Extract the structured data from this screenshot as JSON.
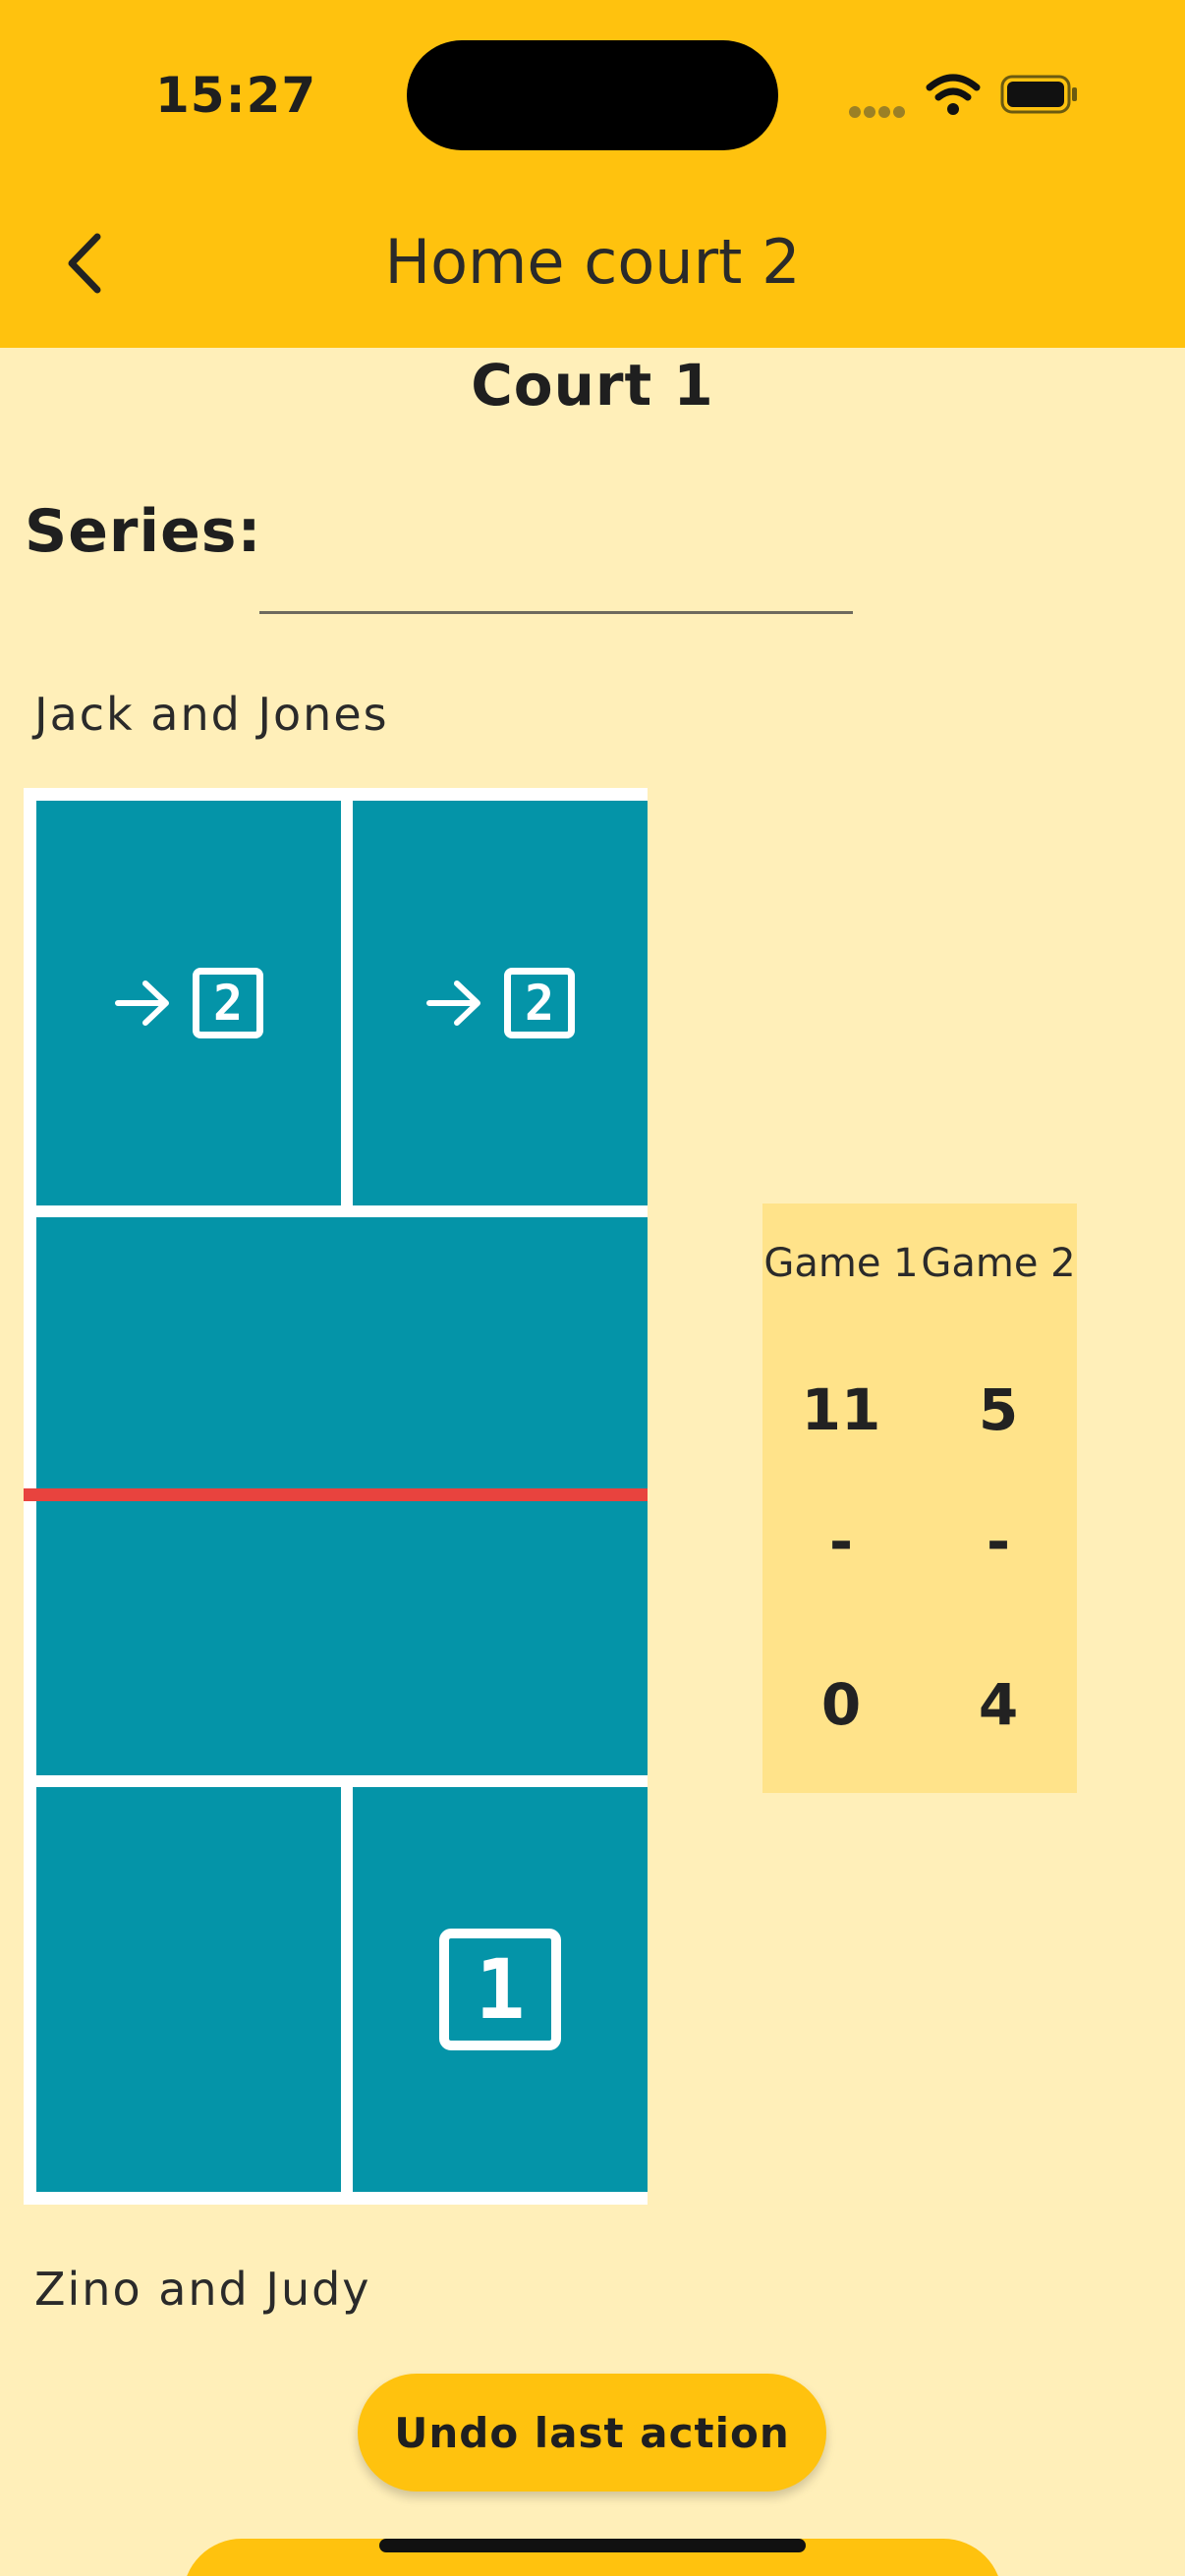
{
  "status_bar": {
    "time": "15:27"
  },
  "app_bar": {
    "title": "Home court 2"
  },
  "court": {
    "title": "Court 1",
    "series_label": "Series:",
    "series_value": "",
    "team_top": "Jack and Jones",
    "team_bottom": "Zino and Judy",
    "top_left_serve_number": "2",
    "top_right_serve_number": "2",
    "bottom_right_server_number": "1"
  },
  "score_table": {
    "headers": [
      "Game 1",
      "Game 2"
    ],
    "top_scores": [
      "11",
      "5"
    ],
    "separators": [
      "-",
      "-"
    ],
    "bottom_scores": [
      "0",
      "4"
    ]
  },
  "actions": {
    "undo_label": "Undo last action"
  },
  "colors": {
    "app_bar": "#FFC20E",
    "background": "#FFEFB9",
    "court": "#0494A8",
    "net": "#E8433E",
    "score_panel": "#FFE38A"
  }
}
